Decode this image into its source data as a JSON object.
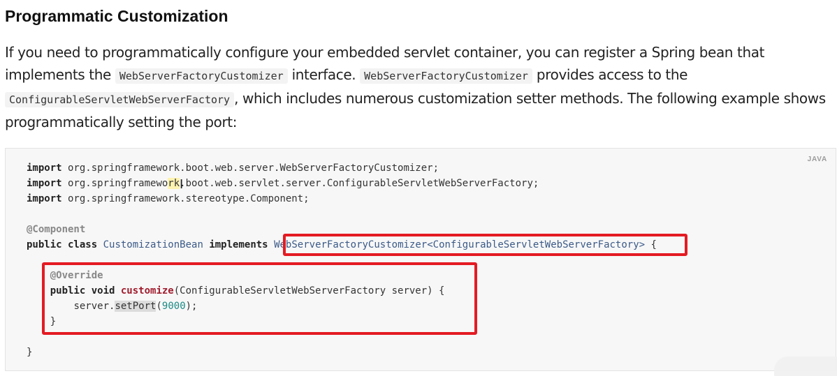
{
  "heading": "Programmatic Customization",
  "paragraph": {
    "t1": "If you need to programmatically configure your embedded servlet container, you can register a Spring bean that implements the ",
    "c1": "WebServerFactoryCustomizer",
    "t2": " interface. ",
    "c2": "WebServerFactoryCustomizer",
    "t3": " provides access to the ",
    "c3": "ConfigurableServletWebServerFactory",
    "t4": ", which includes numerous customization setter methods. The following example shows programmatically setting the port:"
  },
  "code": {
    "language": "JAVA",
    "kw_import": "import",
    "import1": " org.springframework.boot.web.server.WebServerFactoryCustomizer;",
    "import2_a": " org.springframewo",
    "import2_b": "rk",
    "import2_c": ".boot.web.servlet.server.ConfigurableServletWebServerFactory;",
    "import3": " org.springframework.stereotype.Component;",
    "annotation_component": "@Component",
    "kw_public_class": "public class",
    "class_name": "CustomizationBean",
    "kw_implements": "implements",
    "interface": "WebServerFactoryCustomizer<ConfigurableServletWebServerFactory>",
    "brace_open": " {",
    "annotation_override": "@Override",
    "kw_public_void": "public void",
    "method_name": "customize",
    "method_params": "(ConfigurableServletWebServerFactory server) {",
    "stmt_prefix": "server.",
    "stmt_method": "setPort",
    "stmt_open": "(",
    "stmt_value": "9000",
    "stmt_close": ");",
    "brace_close": "}"
  }
}
